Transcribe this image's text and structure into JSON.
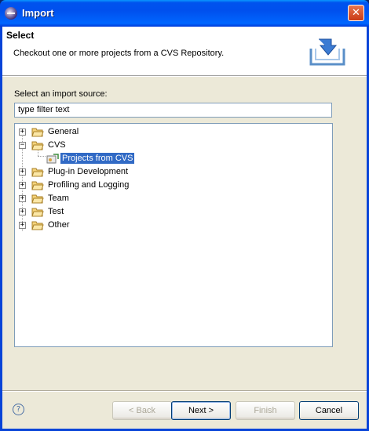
{
  "window": {
    "title": "Import",
    "close_glyph": "✕"
  },
  "header": {
    "title": "Select",
    "description": "Checkout one or more projects from a CVS Repository."
  },
  "source": {
    "label": "Select an import source:",
    "filter_value": "type filter text"
  },
  "tree": {
    "items": [
      {
        "label": "General",
        "expander": "+",
        "icon": "folder-icon"
      },
      {
        "label": "CVS",
        "expander": "−",
        "icon": "folder-open-icon"
      },
      {
        "label": "Projects from CVS",
        "icon": "cvs-checkout-icon",
        "selected": true
      },
      {
        "label": "Plug-in Development",
        "expander": "+",
        "icon": "folder-icon"
      },
      {
        "label": "Profiling and Logging",
        "expander": "+",
        "icon": "folder-icon"
      },
      {
        "label": "Team",
        "expander": "+",
        "icon": "folder-icon"
      },
      {
        "label": "Test",
        "expander": "+",
        "icon": "folder-icon"
      },
      {
        "label": "Other",
        "expander": "+",
        "icon": "folder-icon"
      }
    ]
  },
  "buttons": {
    "help_glyph": "?",
    "back": "< Back",
    "next": "Next >",
    "finish": "Finish",
    "cancel": "Cancel"
  }
}
